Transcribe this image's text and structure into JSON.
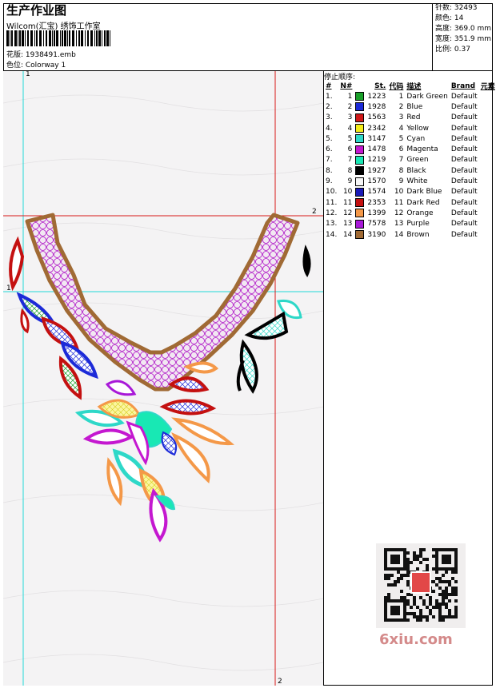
{
  "header": {
    "title": "生产作业图",
    "subtitle": "Wilcom(汇宝) 绣饰工作室",
    "design_label": "花版: 1938491.emb",
    "colorway_label": "色位: Colorway 1"
  },
  "stats": {
    "stitches": "针数: 32493",
    "colors": "颜色: 14",
    "height": "高度: 369.0 mm",
    "width": "宽度: 351.9 mm",
    "scale": "比例: 0.37"
  },
  "table": {
    "title": "停止顺序:",
    "headers": [
      "#",
      "N#",
      "St.",
      "代码",
      "描述",
      "Brand",
      "元素"
    ],
    "rows": [
      {
        "idx": "1.",
        "n": "1",
        "color": "#1aa02a",
        "st": "1223",
        "code": "1",
        "desc": "Dark Green",
        "brand": "Default"
      },
      {
        "idx": "2.",
        "n": "2",
        "color": "#1c2ad8",
        "st": "1928",
        "code": "2",
        "desc": "Blue",
        "brand": "Default"
      },
      {
        "idx": "3.",
        "n": "3",
        "color": "#d01818",
        "st": "1563",
        "code": "3",
        "desc": "Red",
        "brand": "Default"
      },
      {
        "idx": "4.",
        "n": "4",
        "color": "#f4ec18",
        "st": "2342",
        "code": "4",
        "desc": "Yellow",
        "brand": "Default"
      },
      {
        "idx": "5.",
        "n": "5",
        "color": "#2ed8c8",
        "st": "3147",
        "code": "5",
        "desc": "Cyan",
        "brand": "Default"
      },
      {
        "idx": "6.",
        "n": "6",
        "color": "#c418d0",
        "st": "1478",
        "code": "6",
        "desc": "Magenta",
        "brand": "Default"
      },
      {
        "idx": "7.",
        "n": "7",
        "color": "#18e8b4",
        "st": "1219",
        "code": "7",
        "desc": "Green",
        "brand": "Default"
      },
      {
        "idx": "8.",
        "n": "8",
        "color": "#000000",
        "st": "1927",
        "code": "8",
        "desc": "Black",
        "brand": "Default"
      },
      {
        "idx": "9.",
        "n": "9",
        "color": "#f6f6f6",
        "st": "1570",
        "code": "9",
        "desc": "White",
        "brand": "Default"
      },
      {
        "idx": "10.",
        "n": "10",
        "color": "#1a1ab8",
        "st": "1574",
        "code": "10",
        "desc": "Dark Blue",
        "brand": "Default"
      },
      {
        "idx": "11.",
        "n": "11",
        "color": "#c41010",
        "st": "2353",
        "code": "11",
        "desc": "Dark Red",
        "brand": "Default"
      },
      {
        "idx": "12.",
        "n": "12",
        "color": "#f49848",
        "st": "1399",
        "code": "12",
        "desc": "Orange",
        "brand": "Default"
      },
      {
        "idx": "13.",
        "n": "13",
        "color": "#a818d8",
        "st": "7578",
        "code": "13",
        "desc": "Purple",
        "brand": "Default"
      },
      {
        "idx": "14.",
        "n": "14",
        "color": "#a06a34",
        "st": "3190",
        "code": "14",
        "desc": "Brown",
        "brand": "Default"
      }
    ]
  },
  "guides": {
    "label_1": "1",
    "label_2": "2"
  },
  "watermark": "6xiu.com",
  "colors": {
    "guide_cyan": "#22d8d8",
    "guide_red": "#d81818",
    "canvas_bg": "#f4f3f4"
  }
}
